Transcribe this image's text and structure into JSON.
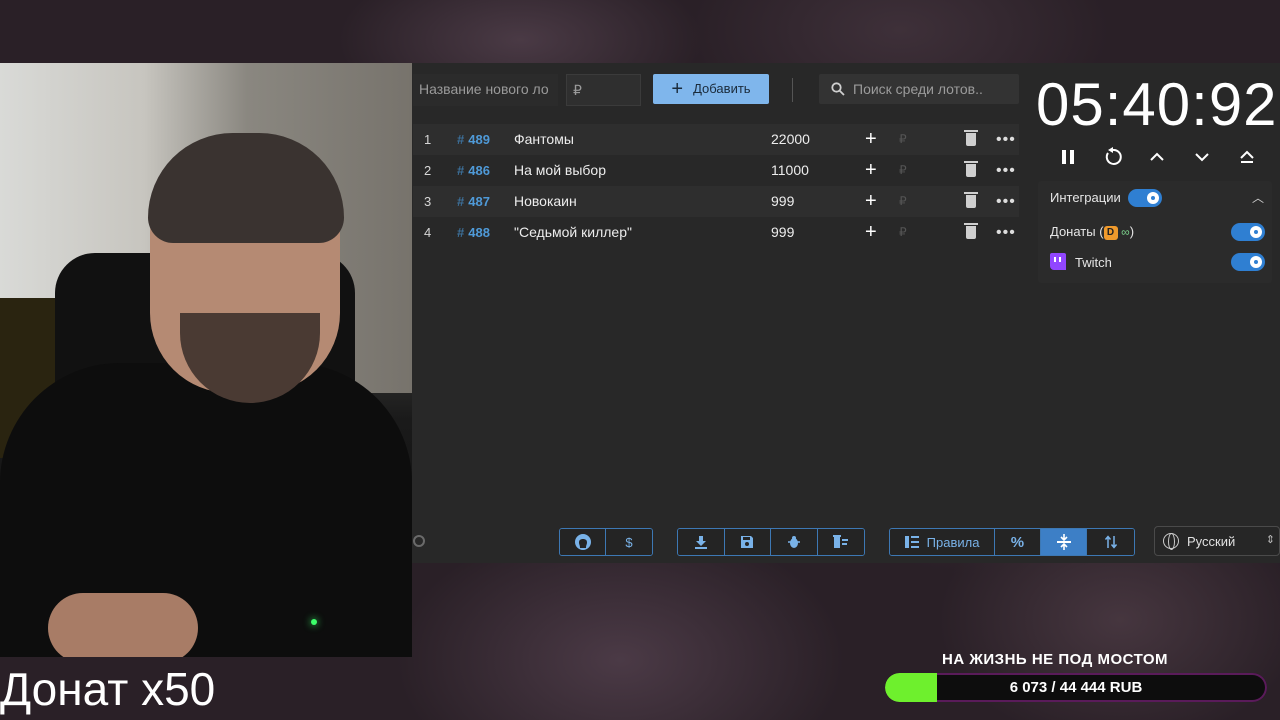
{
  "webcam": {
    "caption": "Донат х50"
  },
  "form": {
    "lot_name_placeholder": "Название нового ло",
    "price_placeholder": "₽",
    "add_label": "Добавить",
    "search_placeholder": "Поиск среди лотов.."
  },
  "lots": [
    {
      "index": "1",
      "id": "489",
      "name": "Фантомы",
      "amount": "22000"
    },
    {
      "index": "2",
      "id": "486",
      "name": "На мой выбор",
      "amount": "11000"
    },
    {
      "index": "3",
      "id": "487",
      "name": "Новокаин",
      "amount": "999"
    },
    {
      "index": "4",
      "id": "488",
      "name": "\"Седьмой киллер\"",
      "amount": "999"
    }
  ],
  "timer": {
    "value": "05:40:92"
  },
  "integrations": {
    "title": "Интеграции",
    "donations_label": "Донаты (",
    "donations_suffix": ")",
    "twitch_label": "Twitch"
  },
  "toolbar": {
    "rules_label": "Правила",
    "percent_label": "%",
    "currency_label": "$"
  },
  "language": {
    "selected": "Русский"
  },
  "goal": {
    "title": "НА ЖИЗНЬ НЕ ПОД МОСТОМ",
    "progress_text": "6 073 / 44 444 RUB",
    "progress_fraction": 0.137
  },
  "colors": {
    "accent": "#3d7fc6",
    "add_button": "#7fb6ec",
    "lot_id": "#4f9ad8",
    "goal_fill": "#6ef02d",
    "twitch": "#9146ff"
  },
  "icons": {
    "search": "search-icon",
    "github": "github-icon",
    "download": "download-icon",
    "save": "save-icon",
    "bug": "bug-icon",
    "clear": "clear-list-icon",
    "rules": "rules-icon",
    "compress": "compress-icon",
    "sort": "sort-icon",
    "globe": "globe-icon",
    "pause": "pause-icon",
    "reset": "reset-icon"
  }
}
